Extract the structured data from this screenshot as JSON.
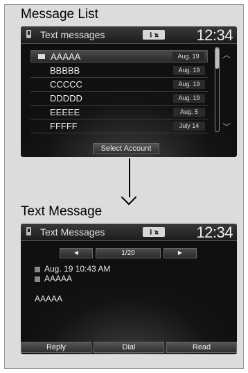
{
  "top": {
    "section_title": "Message List",
    "header_title": "Text messages",
    "status_badge": "ᛒ ℡",
    "clock": "12:34",
    "messages": [
      {
        "name": "AAAAA",
        "date": "Aug. 19"
      },
      {
        "name": "BBBBB",
        "date": "Aug. 19"
      },
      {
        "name": "CCCCC",
        "date": "Aug. 19"
      },
      {
        "name": "DDDDD",
        "date": "Aug. 19"
      },
      {
        "name": "EEEEE",
        "date": "Aug. 5"
      },
      {
        "name": "FFFFF",
        "date": "July 14"
      }
    ],
    "select_account_label": "Select Account"
  },
  "bottom": {
    "section_title": "Text Message",
    "header_title": "Text Messages",
    "status_badge": "ᛒ ℡",
    "clock": "12:34",
    "prev_label": "◄",
    "next_label": "►",
    "page_indicator": "1/20",
    "datetime": "Aug. 19 10:43 AM",
    "sender": "AAAAA",
    "body": "AAAAA",
    "buttons": {
      "reply": "Reply",
      "dial": "Dial",
      "read": "Read"
    }
  },
  "icons": [
    "phone-icon",
    "envelope-icon",
    "bluetooth-icon",
    "chevron-up-icon",
    "chevron-down-icon",
    "clock-icon",
    "contact-icon",
    "arrow-down-icon"
  ]
}
